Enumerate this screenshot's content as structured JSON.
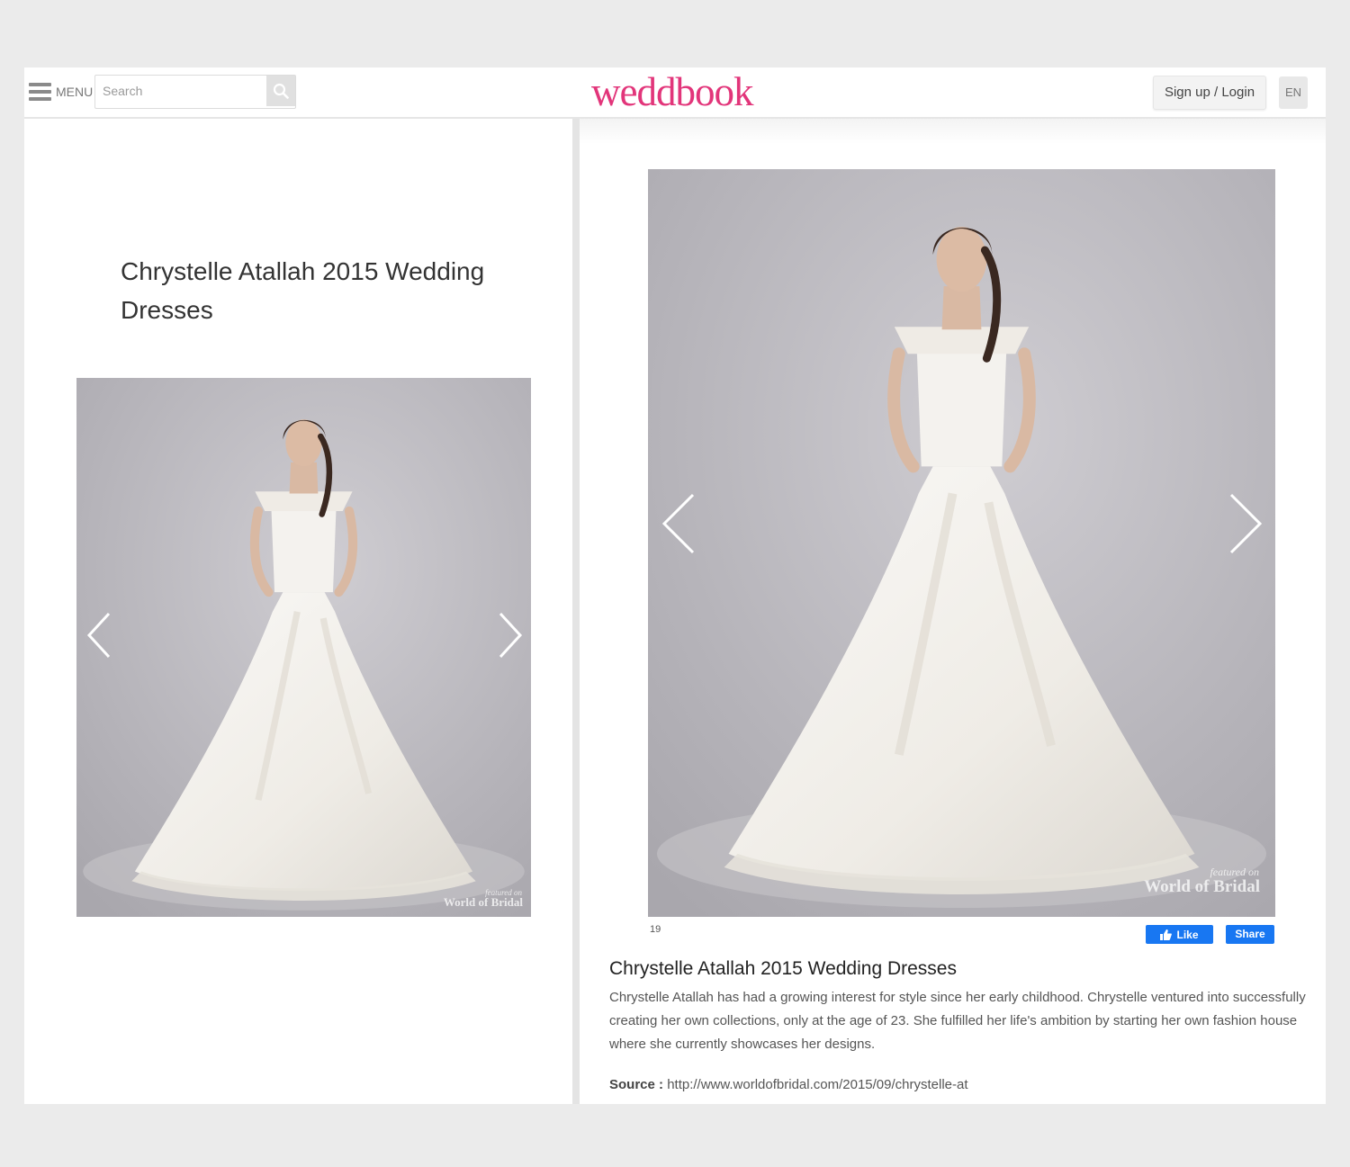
{
  "header": {
    "menu_label": "MENU",
    "search_placeholder": "Search",
    "logo_text": "weddbook",
    "signup_label": "Sign up / Login",
    "lang_label": "EN"
  },
  "left_panel": {
    "title": "Chrystelle Atallah 2015 Wedding Dresses",
    "watermark_small": "featured on",
    "watermark": "World of Bridal"
  },
  "right_panel": {
    "watermark_small": "featured on",
    "watermark": "World of Bridal",
    "counter": "19",
    "like_label": "Like",
    "share_label": "Share",
    "title": "Chrystelle Atallah 2015 Wedding Dresses",
    "description": "Chrystelle Atallah has had a growing interest for style since her early childhood. Chrystelle ventured into successfully creating her own collections, only at the age of 23. She fulfilled her life's ambition by starting her own fashion house where she currently showcases her designs.",
    "source_label": "Source :",
    "source_url": "http://www.worldofbridal.com/2015/09/chrystelle-at"
  },
  "colors": {
    "brand": "#e2357a",
    "facebook": "#1877f2",
    "photo_background": "#b9b7bd"
  },
  "icons": {
    "menu": "hamburger-icon",
    "search": "search-icon",
    "prev": "chevron-left-icon",
    "next": "chevron-right-icon",
    "like": "thumbs-up-icon"
  }
}
